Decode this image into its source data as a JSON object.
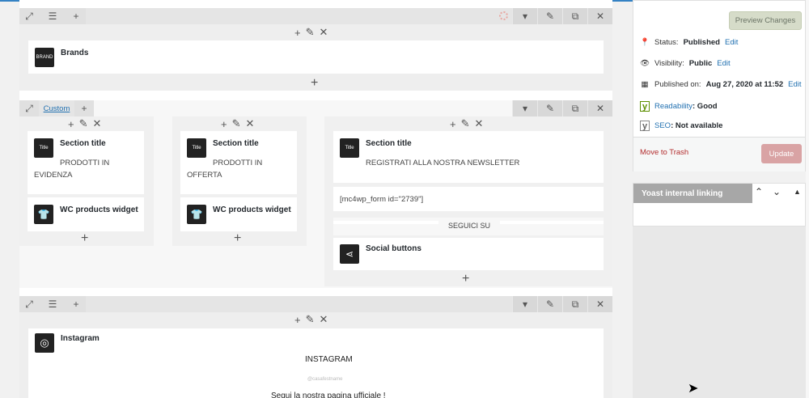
{
  "row1": {
    "module": {
      "title": "Brands",
      "icon": "brand-icon"
    }
  },
  "row2": {
    "custom_label": "Custom",
    "col1": {
      "section": {
        "title": "Section title",
        "text": "PRODOTTI IN EVIDENZA"
      },
      "widget": {
        "title": "WC products widget"
      }
    },
    "col2": {
      "section": {
        "title": "Section title",
        "text": "PRODOTTI IN OFFERTA"
      },
      "widget": {
        "title": "WC products widget"
      }
    },
    "col3": {
      "section": {
        "title": "Section title",
        "text": "REGISTRATI ALLA NOSTRA NEWSLETTER"
      },
      "shortcode": "[mc4wp_form id=\"2739\"]",
      "divider_text": "SEGUICI SU",
      "social": {
        "title": "Social buttons"
      }
    }
  },
  "row3": {
    "module": {
      "title": "Instagram",
      "heading": "INSTAGRAM",
      "handle": "@casafestname",
      "text": "Segui la nostra pagina ufficiale !"
    }
  },
  "publish": {
    "preview_label": "Preview Changes",
    "status_label": "Status:",
    "status_value": "Published",
    "visibility_label": "Visibility:",
    "visibility_value": "Public",
    "published_label": "Published on:",
    "published_value": "Aug 27, 2020 at 11:52",
    "edit_label": "Edit",
    "readability_label": "Readability",
    "readability_value": ": Good",
    "seo_label": "SEO",
    "seo_value": ": Not available",
    "trash_label": "Move to Trash",
    "update_label": "Update"
  },
  "yoast_box": {
    "title": "Yoast internal linking"
  },
  "colors": {
    "accent": "#2271b1",
    "trash": "#b32d2e",
    "update_button": "#d9a3a4",
    "yoast_header": "#a7a7a7",
    "yoast_green": "#5d8f00"
  }
}
